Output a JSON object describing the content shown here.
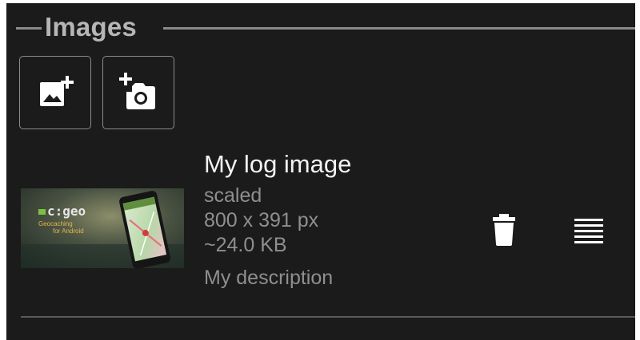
{
  "section": {
    "title": "Images"
  },
  "actions": {
    "add_image_icon": "add-image-icon",
    "add_photo_icon": "add-photo-camera-icon"
  },
  "image_item": {
    "title": "My log image",
    "status": "scaled",
    "dimensions": "800 x 391 px",
    "size": "~24.0 KB",
    "description": "My description",
    "thumbnail": {
      "brand_text": "c:geo",
      "tagline_line1": "Geocaching",
      "tagline_line2": "for Android"
    },
    "delete_icon": "trash-icon",
    "drag_icon": "drag-handle-icon"
  },
  "colors": {
    "background": "#1b1b1b",
    "title_text": "#b6b6b6",
    "primary_text": "#f2f2f2",
    "secondary_text": "#8f8f8f",
    "icon": "#ffffff",
    "brand_green": "#7cc242"
  }
}
